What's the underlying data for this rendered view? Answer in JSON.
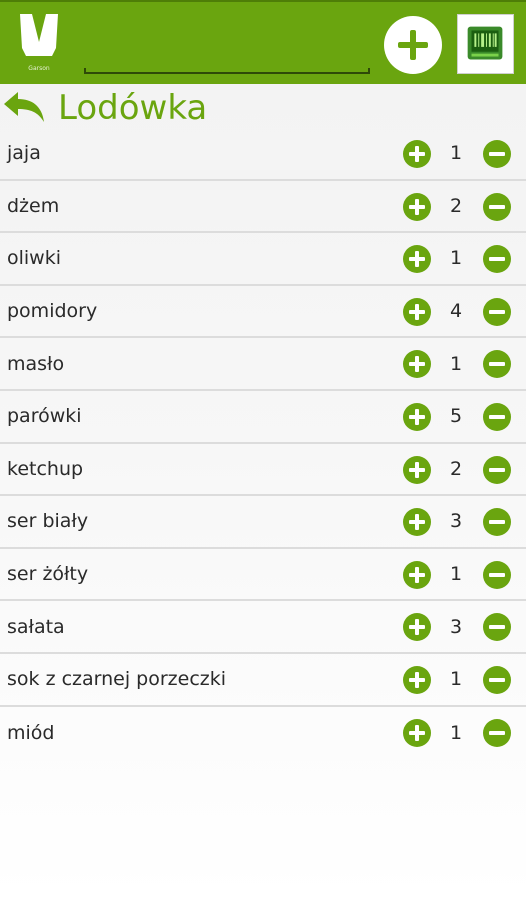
{
  "app": {
    "logo_icon": "waiter-tuxedo-logo-icon",
    "logo_text": "Garson",
    "add_icon": "plus-icon",
    "barcode_icon": "barcode-scanner-icon",
    "accent_color": "#6aa50f"
  },
  "header": {
    "back_icon": "back-arrow-icon",
    "title": "Lodówka"
  },
  "items": [
    {
      "name": "jaja",
      "qty": "1"
    },
    {
      "name": "dżem",
      "qty": "2"
    },
    {
      "name": "oliwki",
      "qty": "1"
    },
    {
      "name": "pomidory",
      "qty": "4"
    },
    {
      "name": "masło",
      "qty": "1"
    },
    {
      "name": "parówki",
      "qty": "5"
    },
    {
      "name": "ketchup",
      "qty": "2"
    },
    {
      "name": "ser biały",
      "qty": "3"
    },
    {
      "name": "ser żółty",
      "qty": "1"
    },
    {
      "name": "sałata",
      "qty": "3"
    },
    {
      "name": "sok z czarnej porzeczki",
      "qty": "1"
    },
    {
      "name": "miód",
      "qty": "1"
    }
  ]
}
